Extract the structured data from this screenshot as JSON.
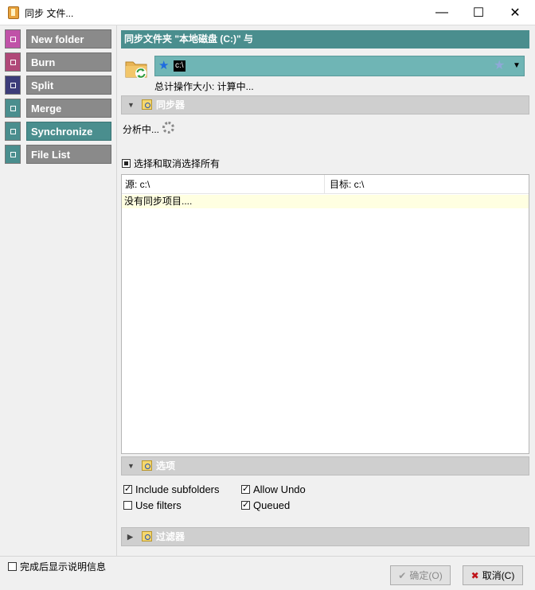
{
  "window": {
    "title": "同步 文件...",
    "minimize_glyph": "—",
    "maximize_glyph": "☐",
    "close_glyph": "✕"
  },
  "sidebar": {
    "items": [
      {
        "label": "New folder",
        "color": "#c052a8"
      },
      {
        "label": "Burn",
        "color": "#b04878"
      },
      {
        "label": "Split",
        "color": "#3c3c7a"
      },
      {
        "label": "Merge",
        "color": "#4a8e8e"
      },
      {
        "label": "Synchronize",
        "color": "#4a8e8e",
        "active": true
      },
      {
        "label": "File List",
        "color": "#4a8e8e"
      }
    ]
  },
  "main": {
    "header": "同步文件夹 \"本地磁盘 (C:)\" 与",
    "path": "c:\\",
    "total_size": "总计操作大小: 计算中...",
    "sections": {
      "synchronizer": "同步器",
      "options": "选项",
      "filters": "过滤器"
    },
    "analyzing": "分析中...",
    "select_all": "选择和取消选择所有",
    "columns": {
      "source": "源: c:\\",
      "target": "目标: c:\\"
    },
    "no_items": "没有同步项目....",
    "options": {
      "include_subfolders": "Include subfolders",
      "allow_undo": "Allow Undo",
      "use_filters": "Use filters",
      "queued": "Queued"
    }
  },
  "footer": {
    "show_info": "完成后显示说明信息",
    "ok_label": "确定(O)",
    "cancel_label": "取消(C)"
  },
  "icons": {
    "star": "★",
    "dropdown": "▼",
    "collapse": "▼",
    "expand": "▶",
    "ok": "✔",
    "cancel": "✖"
  }
}
